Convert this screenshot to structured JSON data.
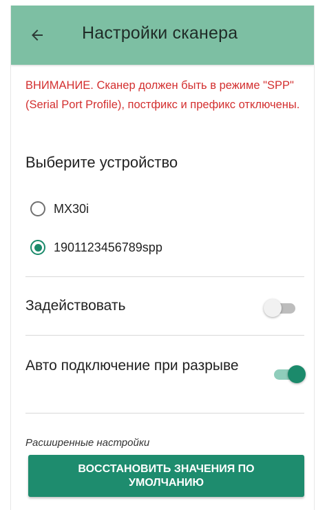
{
  "appbar": {
    "title": "Настройки сканера",
    "color": "#7dbfa3"
  },
  "warning": {
    "text": "ВНИМАНИЕ. Сканер должен быть в режиме \"SPP\" (Serial Port Profile), постфикс и префикс отключены.",
    "color": "#d32f2f"
  },
  "device_section": {
    "title": "Выберите устройство",
    "options": [
      {
        "label": "MX30i",
        "selected": false
      },
      {
        "label": "1901123456789spp",
        "selected": true
      }
    ]
  },
  "settings": {
    "enable": {
      "label": "Задействовать",
      "on": false
    },
    "auto_reconnect": {
      "label": "Авто подключение при разрыве",
      "on": true
    }
  },
  "advanced": {
    "subheader": "Расширенные настройки",
    "reset_button": "ВОССТАНОВИТЬ ЗНАЧЕНИЯ ПО УМОЛЧАНИЮ"
  },
  "colors": {
    "accent": "#1b8a6b",
    "button": "#1e8c6e"
  },
  "icons": {
    "back": "arrow-left-icon"
  }
}
